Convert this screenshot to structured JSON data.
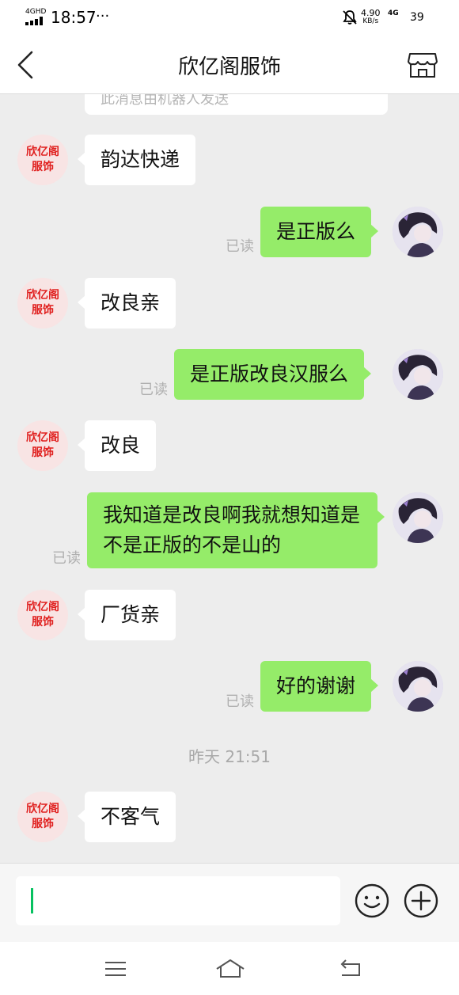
{
  "status_bar": {
    "network": "4GHD",
    "time": "18:57",
    "more": "···",
    "speed_value": "4.90",
    "speed_unit": "KB/s",
    "network_type": "4G",
    "battery": "39"
  },
  "header": {
    "title": "欣亿阁服饰"
  },
  "system_notice": "此消息由机器人发送",
  "shop_avatar_text": "欣亿阁\n服饰",
  "messages": [
    {
      "side": "left",
      "text": "韵达快递"
    },
    {
      "side": "right",
      "text": "是正版么",
      "status": "已读"
    },
    {
      "side": "left",
      "text": "改良亲"
    },
    {
      "side": "right",
      "text": "是正版改良汉服么",
      "status": "已读"
    },
    {
      "side": "left",
      "text": "改良"
    },
    {
      "side": "right",
      "text": "我知道是改良啊我就想知道是不是正版的不是山的",
      "status": "已读"
    },
    {
      "side": "left",
      "text": "厂货亲"
    },
    {
      "side": "right",
      "text": "好的谢谢",
      "status": "已读"
    },
    {
      "side": "left",
      "text": "不客气"
    }
  ],
  "timestamp": "昨天 21:51",
  "input": {
    "value": "",
    "emoji_icon": "smiley-icon",
    "plus_icon": "plus-circle-icon"
  },
  "colors": {
    "sent_bubble": "#95ec69",
    "received_bubble": "#ffffff",
    "background": "#ededed",
    "shop_avatar_text": "#e0201f",
    "cursor": "#07c160"
  }
}
